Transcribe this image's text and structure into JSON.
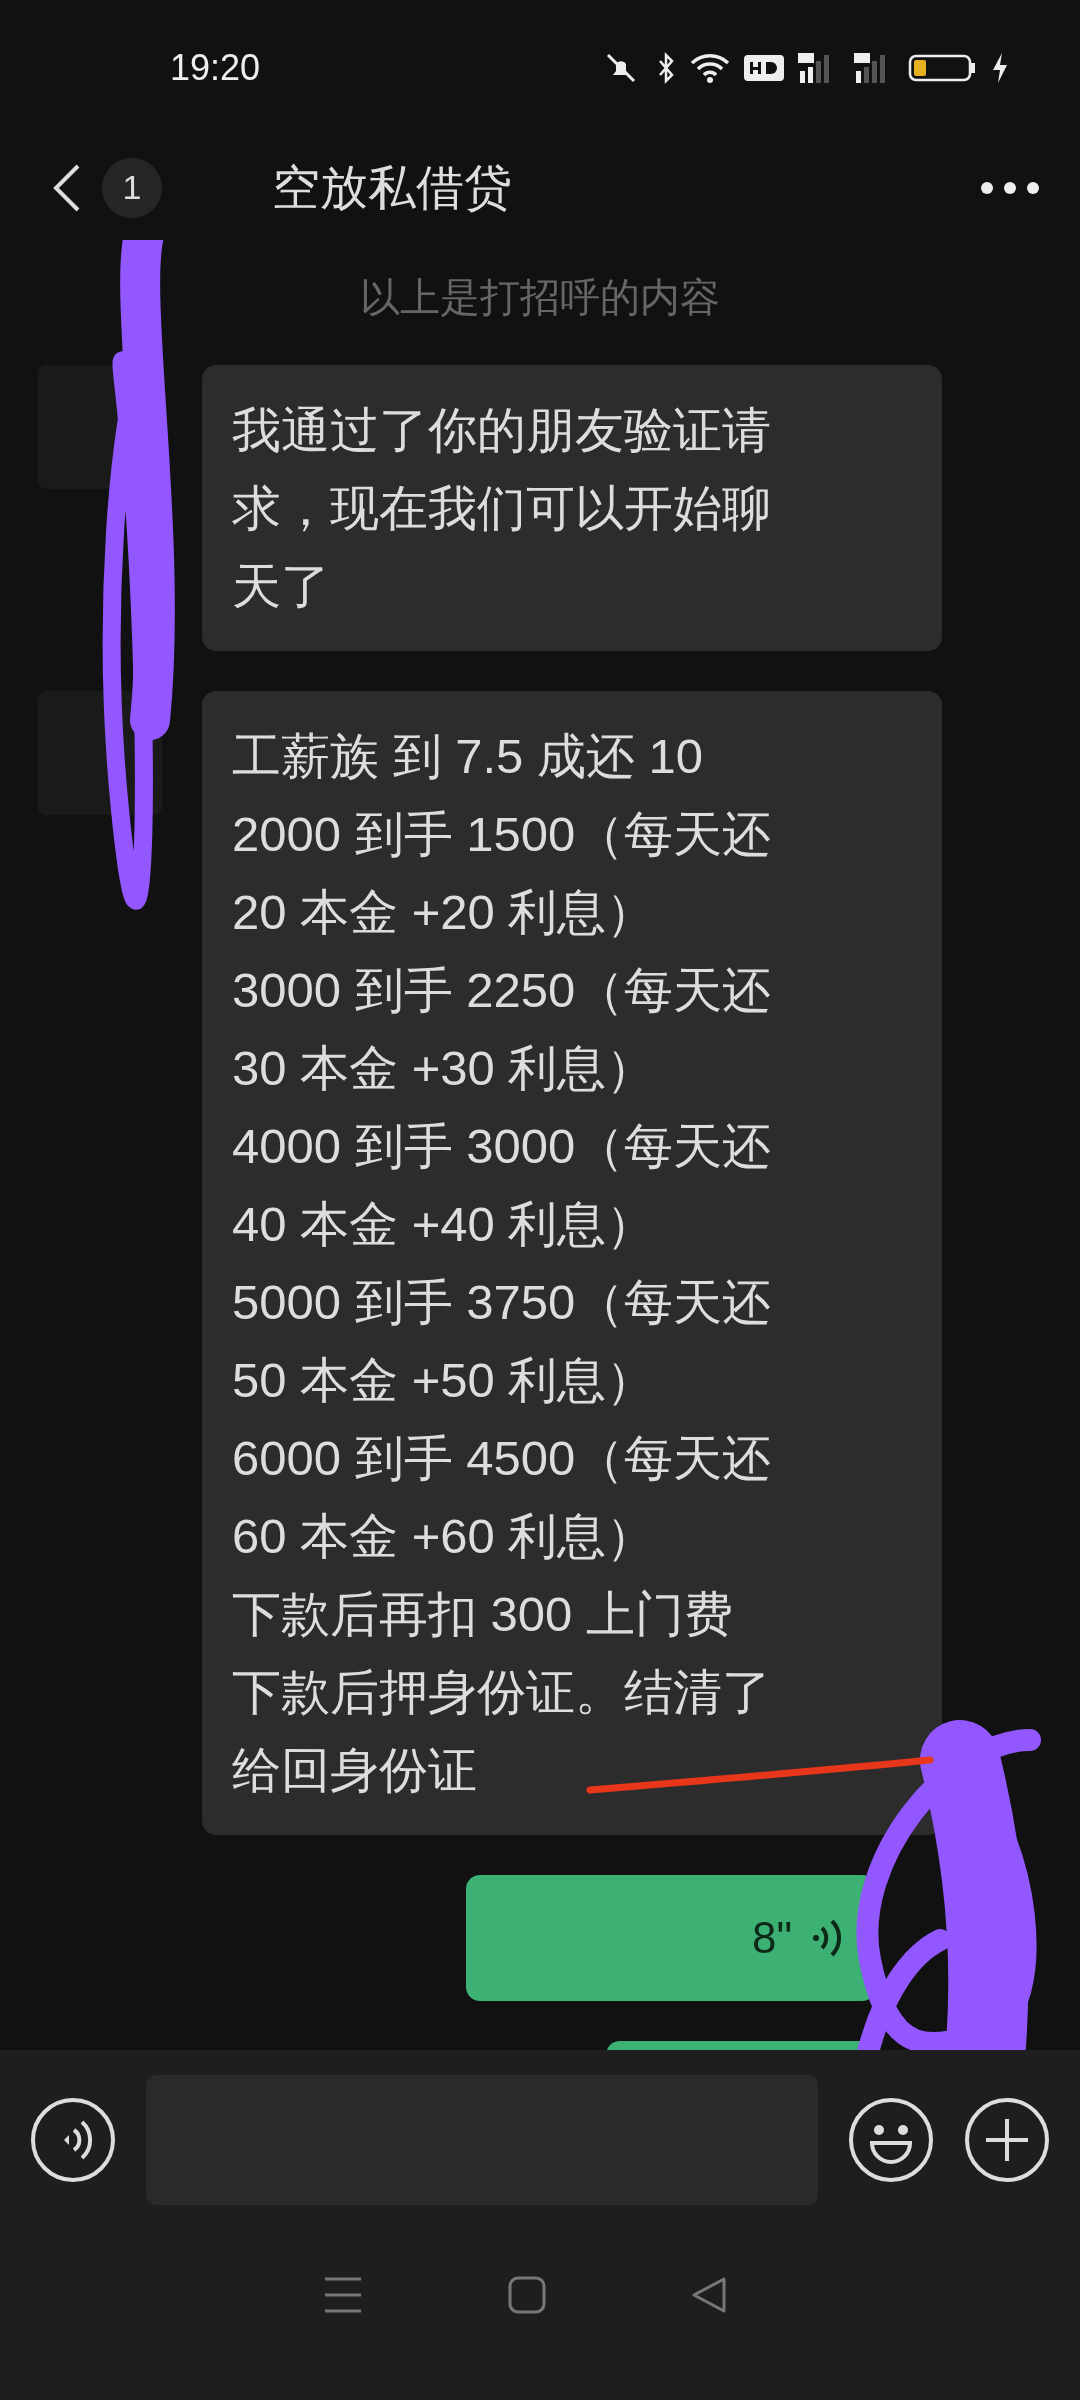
{
  "status_bar": {
    "time": "19:20"
  },
  "header": {
    "unread_count": "1",
    "title": "空放私借贷"
  },
  "notice": "以上是打招呼的内容",
  "messages": [
    {
      "kind": "text",
      "outgoing": false,
      "lines": [
        "我通过了你的朋友验证请",
        "求，现在我们可以开始聊",
        "天了"
      ]
    },
    {
      "kind": "text",
      "outgoing": false,
      "lines": [
        "工薪族   到 7.5 成还 10",
        "2000 到手 1500（每天还",
        "20 本金 +20 利息）",
        "3000 到手 2250（每天还",
        "30 本金 +30 利息）",
        "4000 到手 3000（每天还",
        "40 本金 +40 利息）",
        "5000 到手 3750（每天还",
        "50 本金 +50 利息）",
        "6000 到手 4500（每天还",
        "60 本金 +60 利息）",
        "下款后再扣 300 上门费",
        "下款后押身份证。结清了",
        "给回身份证"
      ]
    },
    {
      "kind": "voice",
      "outgoing": true,
      "duration": "8\""
    },
    {
      "kind": "cut",
      "outgoing": true
    }
  ]
}
